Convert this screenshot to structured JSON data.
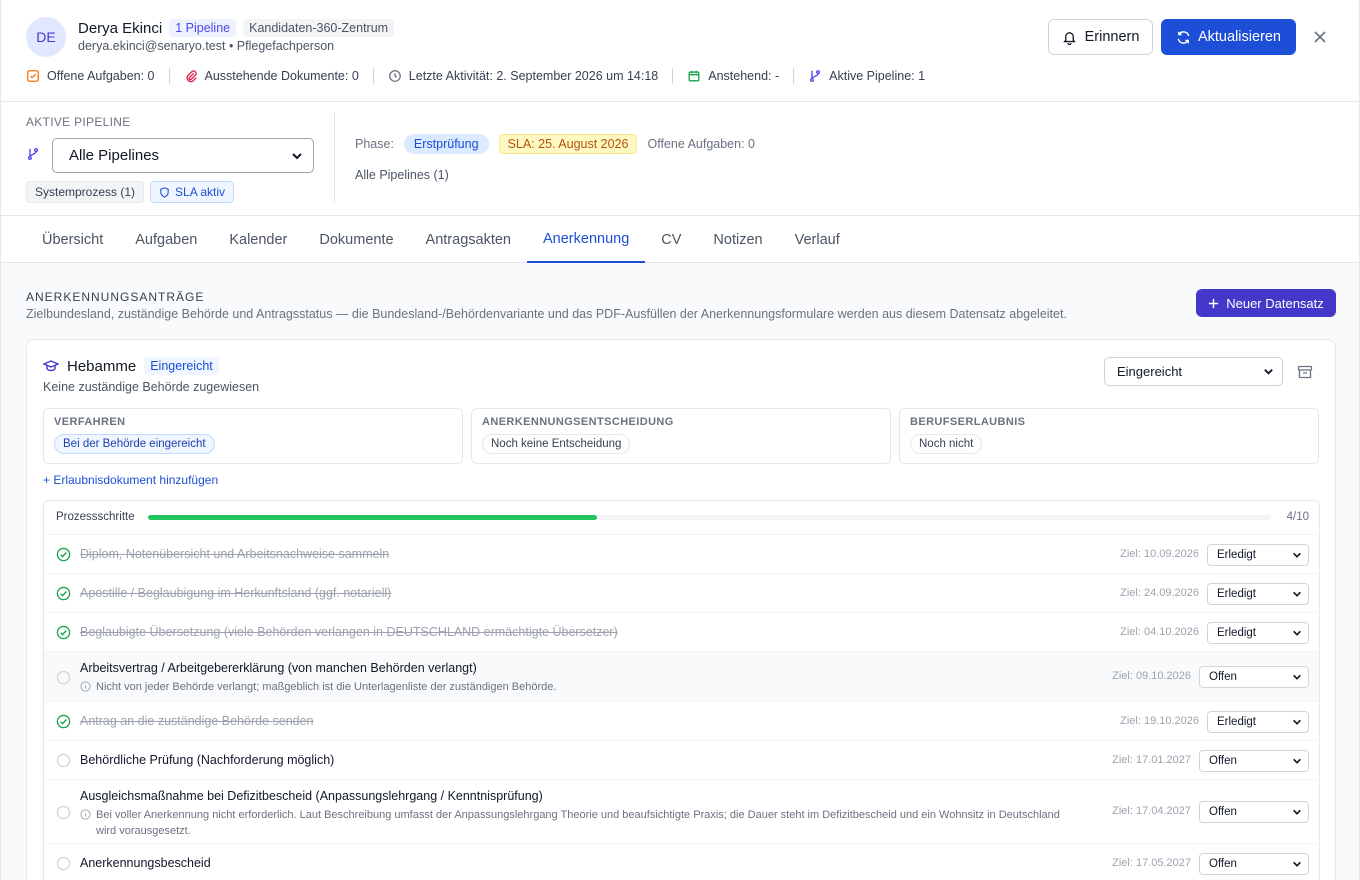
{
  "header": {
    "avatar_initials": "DE",
    "name": "Derya Ekinci",
    "pipeline_badge": "1 Pipeline",
    "center_badge": "Kandidaten-360-Zentrum",
    "email_line": "derya.ekinci@senaryo.test • Pflegefachperson",
    "stats": {
      "open_tasks": "Offene Aufgaben: 0",
      "pending_docs": "Ausstehende Dokumente: 0",
      "last_activity": "Letzte Aktivität: 2. September 2026 um 14:18",
      "upcoming": "Anstehend: -",
      "active_pipeline": "Aktive Pipeline: 1"
    },
    "remind_label": "Erinnern",
    "refresh_label": "Aktualisieren"
  },
  "pipeline": {
    "title": "AKTIVE PIPELINE",
    "select_value": "Alle Pipelines",
    "tag_system": "Systemprozess (1)",
    "tag_sla": "SLA aktiv",
    "phase_label": "Phase:",
    "phase_value": "Erstprüfung",
    "sla_value": "SLA: 25. August 2026",
    "open_tasks": "Offene Aufgaben: 0",
    "all_pipelines": "Alle Pipelines (1)"
  },
  "tabs": [
    {
      "label": "Übersicht"
    },
    {
      "label": "Aufgaben"
    },
    {
      "label": "Kalender"
    },
    {
      "label": "Dokumente"
    },
    {
      "label": "Antragsakten"
    },
    {
      "label": "Anerkennung"
    },
    {
      "label": "CV"
    },
    {
      "label": "Notizen"
    },
    {
      "label": "Verlauf"
    }
  ],
  "active_tab": "Anerkennung",
  "section": {
    "title": "ANERKENNUNGSANTRÄGE",
    "description": "Zielbundesland, zuständige Behörde und Antragsstatus — die Bundesland-/Behördenvariante und das PDF-Ausfüllen der Anerkennungsformulare werden aus diesem Datensatz abgeleitet.",
    "new_button": "Neuer Datensatz"
  },
  "card": {
    "name": "Hebamme",
    "status_badge": "Eingereicht",
    "subtitle": "Keine zuständige Behörde zugewiesen",
    "status_select": "Eingereicht",
    "boxes": [
      {
        "label": "VERFAHREN",
        "value": "Bei der Behörde eingereicht"
      },
      {
        "label": "ANERKENNUNGSENTSCHEIDUNG",
        "value": "Noch keine Entscheidung"
      },
      {
        "label": "BERUFSERLAUBNIS",
        "value": "Noch nicht"
      }
    ],
    "add_link": "+ Erlaubnisdokument hinzufügen"
  },
  "steps": {
    "label": "Prozessschritte",
    "done": 4,
    "total": 10,
    "count_text": "4/10",
    "items": [
      {
        "title": "Diplom, Notenübersicht und Arbeitsnachweise sammeln",
        "target": "Ziel: 10.09.2026",
        "status": "Erledigt",
        "done": true,
        "note": ""
      },
      {
        "title": "Apostille / Beglaubigung im Herkunftsland (ggf. notariell)",
        "target": "Ziel: 24.09.2026",
        "status": "Erledigt",
        "done": true,
        "note": ""
      },
      {
        "title": "Beglaubigte Übersetzung (viele Behörden verlangen in DEUTSCHLAND ermächtigte Übersetzer)",
        "target": "Ziel: 04.10.2026",
        "status": "Erledigt",
        "done": true,
        "note": ""
      },
      {
        "title": "Arbeitsvertrag / Arbeitgebererklärung (von manchen Behörden verlangt)",
        "target": "Ziel: 09.10.2026",
        "status": "Offen",
        "done": false,
        "note": "Nicht von jeder Behörde verlangt; maßgeblich ist die Unterlagenliste der zuständigen Behörde."
      },
      {
        "title": "Antrag an die zuständige Behörde senden",
        "target": "Ziel: 19.10.2026",
        "status": "Erledigt",
        "done": true,
        "note": ""
      },
      {
        "title": "Behördliche Prüfung (Nachforderung möglich)",
        "target": "Ziel: 17.01.2027",
        "status": "Offen",
        "done": false,
        "note": ""
      },
      {
        "title": "Ausgleichsmaßnahme bei Defizitbescheid (Anpassungslehrgang / Kenntnisprüfung)",
        "target": "Ziel: 17.04.2027",
        "status": "Offen",
        "done": false,
        "note": "Bei voller Anerkennung nicht erforderlich. Laut Beschreibung umfasst der Anpassungslehrgang Theorie und beaufsichtigte Praxis; die Dauer steht im Defizitbescheid und ein Wohnsitz in Deutschland wird vorausgesetzt."
      },
      {
        "title": "Anerkennungsbescheid",
        "target": "Ziel: 17.05.2027",
        "status": "Offen",
        "done": false,
        "note": ""
      }
    ]
  },
  "colors": {
    "primary": "#1d4ed8",
    "indigo_button": "#4338ca",
    "progress": "#22c55e"
  }
}
